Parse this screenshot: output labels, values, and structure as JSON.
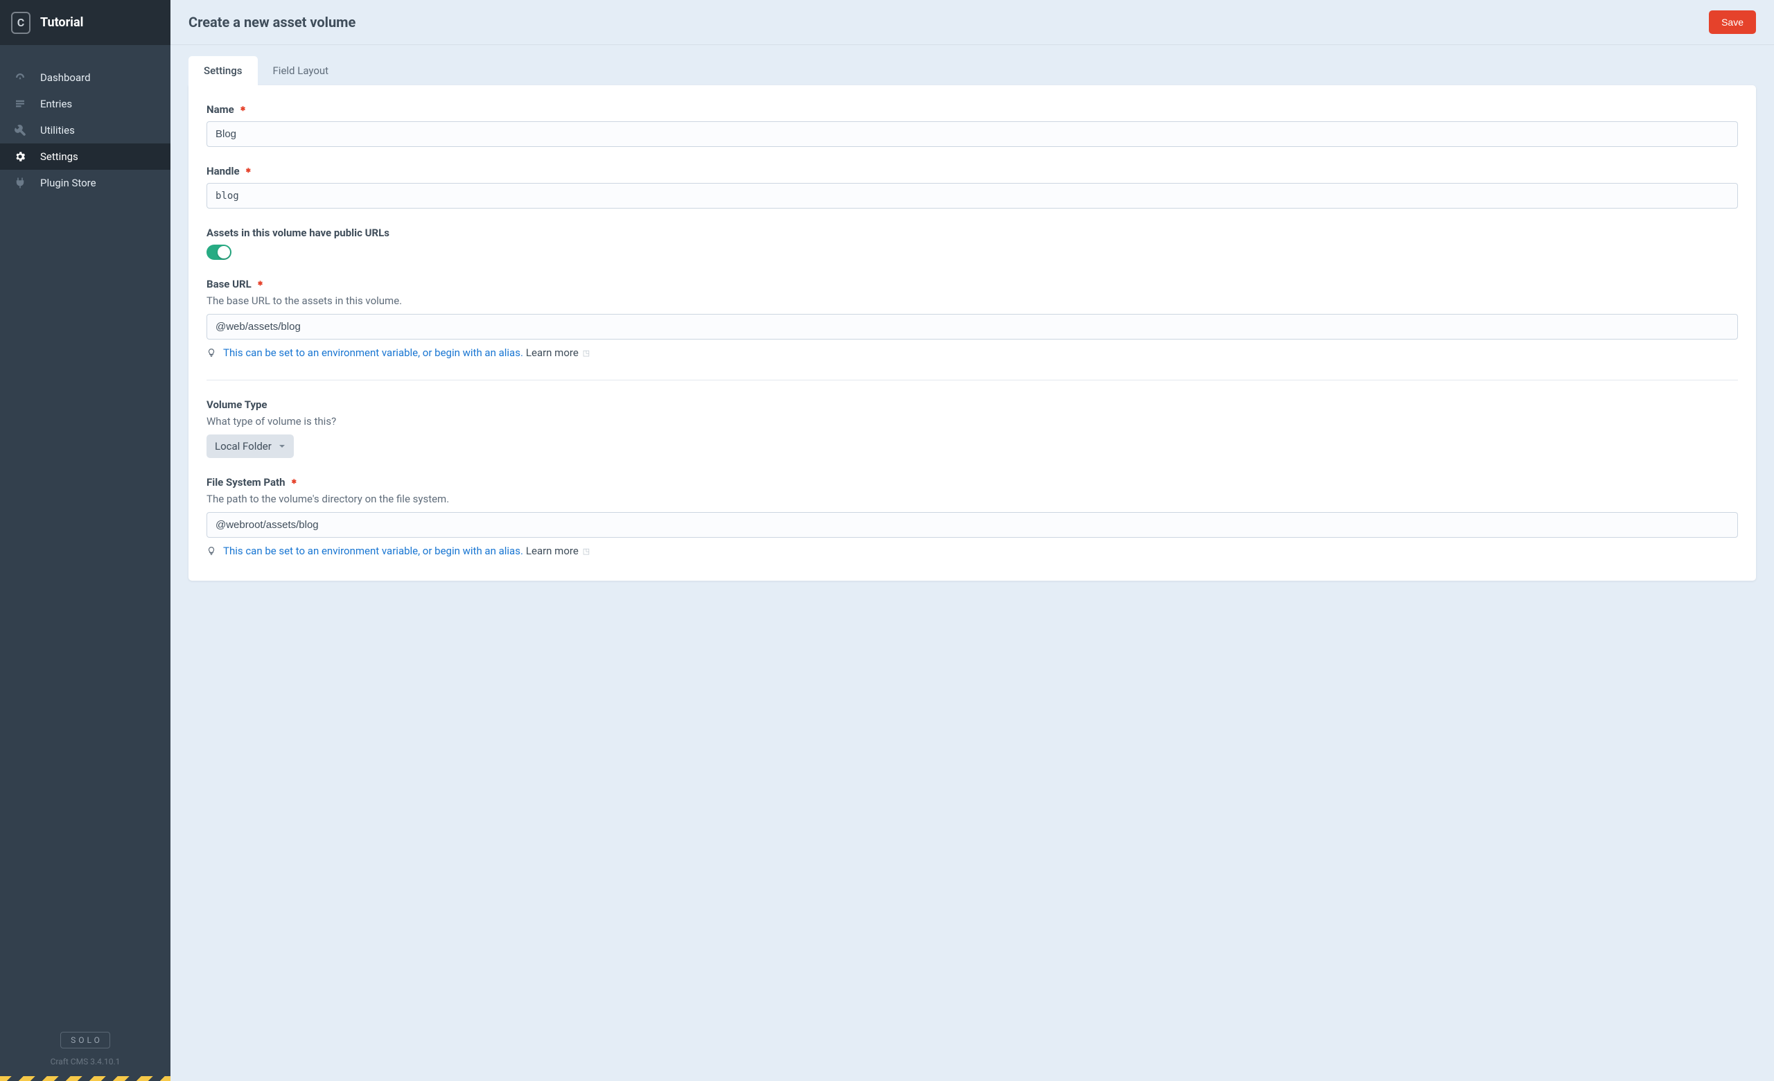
{
  "header": {
    "logo_letter": "C",
    "site_name": "Tutorial",
    "page_title": "Create a new asset volume",
    "save_label": "Save"
  },
  "sidebar": {
    "items": [
      {
        "label": "Dashboard",
        "icon": "dashboard-icon",
        "active": false
      },
      {
        "label": "Entries",
        "icon": "entries-icon",
        "active": false
      },
      {
        "label": "Utilities",
        "icon": "utilities-icon",
        "active": false
      },
      {
        "label": "Settings",
        "icon": "settings-icon",
        "active": true
      },
      {
        "label": "Plugin Store",
        "icon": "plugin-store-icon",
        "active": false
      }
    ],
    "edition": "SOLO",
    "version": "Craft CMS 3.4.10.1"
  },
  "tabs": {
    "settings": "Settings",
    "field_layout": "Field Layout"
  },
  "fields": {
    "name": {
      "label": "Name",
      "value": "Blog"
    },
    "handle": {
      "label": "Handle",
      "value": "blog"
    },
    "public_urls": {
      "label": "Assets in this volume have public URLs",
      "value": true
    },
    "base_url": {
      "label": "Base URL",
      "help": "The base URL to the assets in this volume.",
      "value": "@web/assets/blog",
      "tip_link": "This can be set to an environment variable, or begin with an alias.",
      "tip_learn_more": "Learn more"
    },
    "volume_type": {
      "label": "Volume Type",
      "help": "What type of volume is this?",
      "value": "Local Folder"
    },
    "fs_path": {
      "label": "File System Path",
      "help": "The path to the volume's directory on the file system.",
      "value": "@webroot/assets/blog",
      "tip_link": "This can be set to an environment variable, or begin with an alias.",
      "tip_learn_more": "Learn more"
    }
  }
}
